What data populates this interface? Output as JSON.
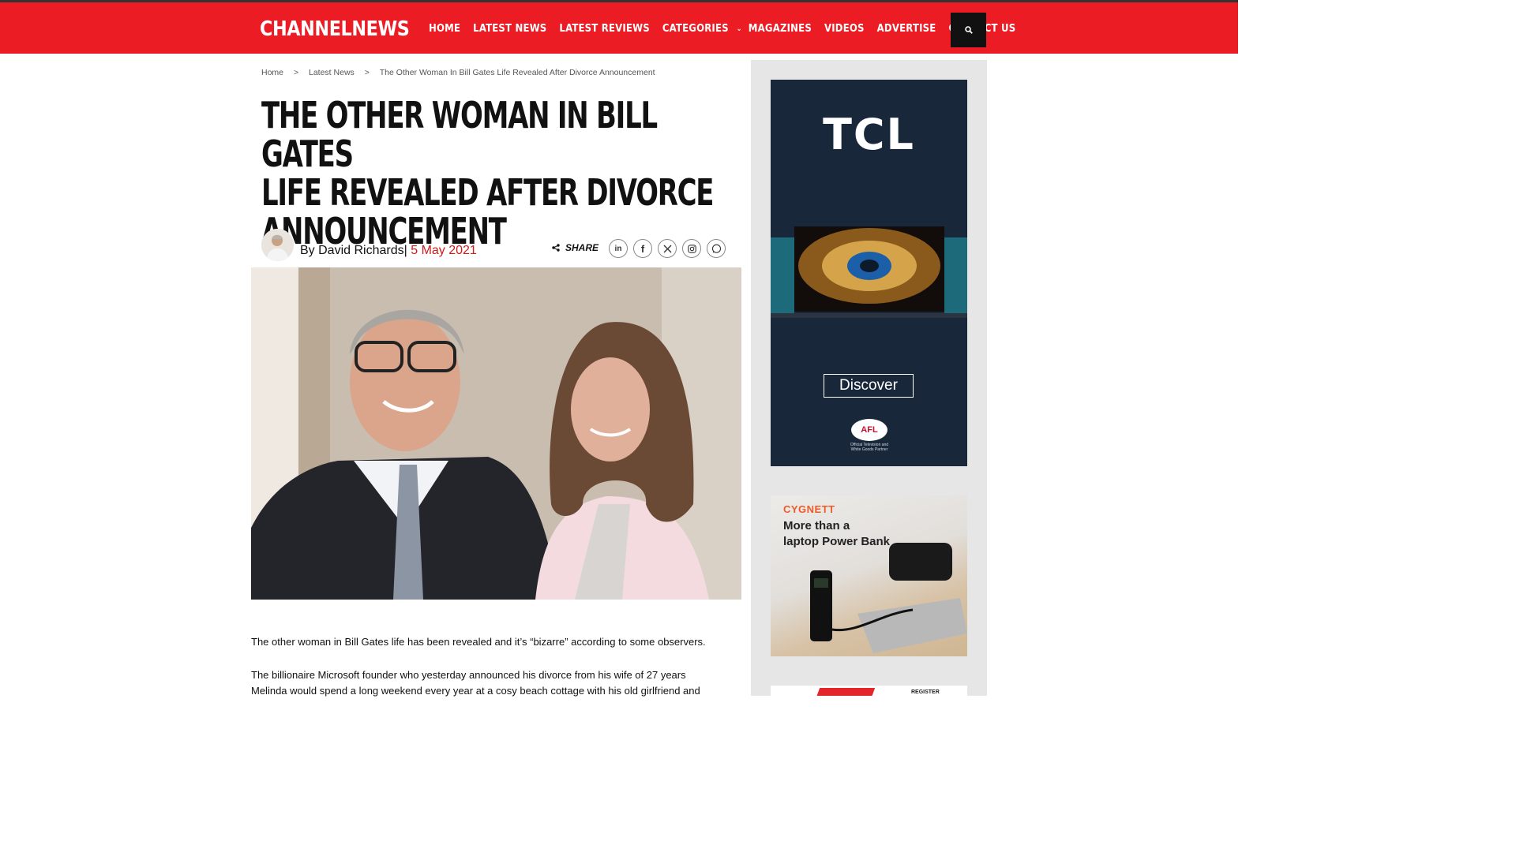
{
  "site": {
    "logo": "CHANNELNEWS",
    "nav": [
      {
        "label": "HOME"
      },
      {
        "label": "LATEST NEWS"
      },
      {
        "label": "LATEST REVIEWS"
      },
      {
        "label": "CATEGORIES"
      },
      {
        "label": "MAGAZINES"
      },
      {
        "label": "VIDEOS"
      },
      {
        "label": "ADVERTISE"
      },
      {
        "label": "CONTACT US"
      }
    ],
    "search_icon": "search-icon"
  },
  "breadcrumb": {
    "items": [
      "Home",
      "Latest News",
      "The Other Woman In Bill Gates Life Revealed After Divorce Announcement"
    ],
    "separator": ">"
  },
  "article": {
    "title_lines": [
      "THE OTHER WOMAN IN BILL GATES",
      "LIFE REVEALED AFTER DIVORCE",
      "ANNOUNCEMENT"
    ],
    "byline_prefix": "By David Richards|",
    "date": "5 May 2021",
    "share_label": "SHARE",
    "social": [
      "linkedin-icon",
      "facebook-icon",
      "x-icon",
      "instagram-icon",
      "whatsapp-icon"
    ],
    "paragraphs": [
      "The other woman in Bill Gates life has been revealed and it’s “bizarre” according to some observers.",
      "The billionaire Microsoft founder who yesterday announced his divorce from his wife of 27 years",
      "Melinda would spend a long weekend every year at a cosy beach cottage with his old girlfriend and"
    ]
  },
  "ads": {
    "tcl": {
      "brand": "TCL",
      "cta": "Discover",
      "badge": "AFL",
      "badge_sub": "Official Television and White Goods Partner"
    },
    "cygnett": {
      "brand": "CYGNETT",
      "headline_1": "More than a",
      "headline_2": "laptop Power Bank"
    },
    "third": {
      "label": "REGISTER"
    }
  },
  "colors": {
    "brand_red": "#ec1c24",
    "date_red": "#d11a1a",
    "dark": "#111111"
  }
}
